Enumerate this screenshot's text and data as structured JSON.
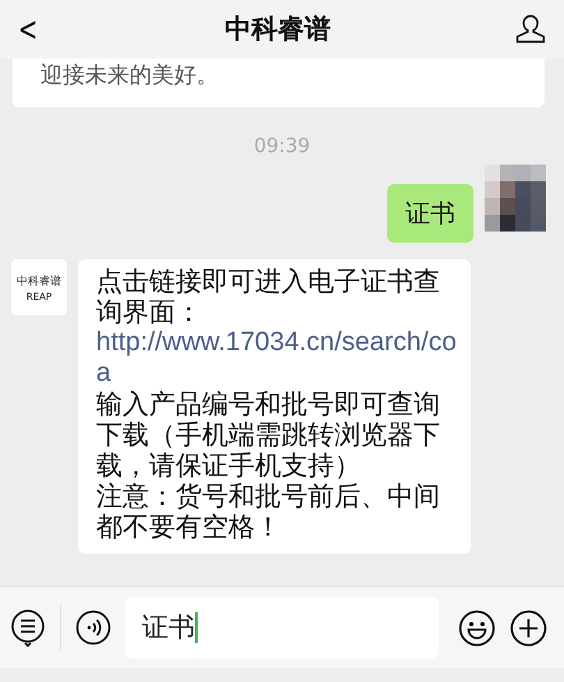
{
  "header": {
    "back": "<",
    "title": "中科睿谱"
  },
  "messages": [
    {
      "kind": "card",
      "text": "迎接未来的美好。"
    },
    {
      "kind": "time",
      "text": "09:39"
    },
    {
      "kind": "sent",
      "text": "证书"
    },
    {
      "kind": "received",
      "logo": [
        "中科睿谱",
        "REAP"
      ],
      "paragraphs": [
        {
          "text": "点击链接即可进入电子证书查询界面：",
          "link": "http://www.17034.cn/search/coa"
        },
        {
          "text": "输入产品编号和批号即可查询下载（手机端需跳转浏览器下载，请保证手机支持）"
        },
        {
          "text": "注意：货号和批号前后、中间都不要有空格！"
        }
      ]
    }
  ],
  "input": {
    "value": "证书"
  }
}
